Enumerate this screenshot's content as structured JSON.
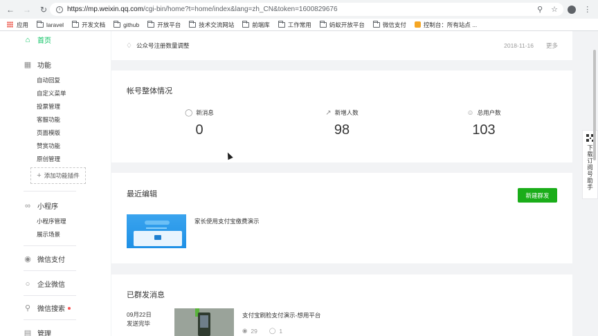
{
  "browser": {
    "url_host": "https://mp.weixin.qq.com",
    "url_path": "/cgi-bin/home?t=home/index&lang=zh_CN&token=1600829676",
    "bookmarks": [
      {
        "label": "应用",
        "icon": "apps-grid-icon"
      },
      {
        "label": "laravel",
        "icon": "folder-icon"
      },
      {
        "label": "开发文档",
        "icon": "folder-icon"
      },
      {
        "label": "github",
        "icon": "folder-icon"
      },
      {
        "label": "开放平台",
        "icon": "folder-icon"
      },
      {
        "label": "技术交流网站",
        "icon": "folder-icon"
      },
      {
        "label": "前端库",
        "icon": "folder-icon"
      },
      {
        "label": "工作常用",
        "icon": "folder-icon"
      },
      {
        "label": "蚂蚁开放平台",
        "icon": "folder-icon"
      },
      {
        "label": "微信支付",
        "icon": "folder-icon"
      },
      {
        "label": "控制台：所有站点 ...",
        "icon": "site-icon"
      }
    ]
  },
  "sidebar": {
    "home": "首页",
    "features": "功能",
    "feature_items": [
      "自动回复",
      "自定义菜单",
      "投票管理",
      "客服功能",
      "页面模版",
      "赞赏功能",
      "原创管理"
    ],
    "add_plugin": "添加功能插件",
    "miniprogram": "小程序",
    "miniprogram_items": [
      "小程序管理",
      "展示场景"
    ],
    "wechat_pay": "微信支付",
    "work_wechat": "企业微信",
    "wechat_search": "微信搜索",
    "management": "管理"
  },
  "notice": {
    "text": "公众号注册数量调整",
    "date": "2018-11-16",
    "more": "更多"
  },
  "stats": {
    "title": "帐号整体情况",
    "items": [
      {
        "label": "新消息",
        "value": "0",
        "icon": "message-bubble-icon"
      },
      {
        "label": "新增人数",
        "value": "98",
        "icon": "trend-up-icon"
      },
      {
        "label": "总用户数",
        "value": "103",
        "icon": "user-icon"
      }
    ]
  },
  "recent": {
    "title": "最近编辑",
    "new_button": "新建群发",
    "item_title": "家长使用支付宝缴费演示"
  },
  "sent": {
    "title": "已群发消息",
    "date": "09月22日",
    "status": "发送完毕",
    "message_title": "支付宝刷脸支付演示-想用平台",
    "views": "29",
    "likes": "1"
  },
  "float": {
    "text": "下载订阅号助手"
  },
  "colors": {
    "accent_green": "#07c160",
    "button_green": "#1aad19"
  }
}
